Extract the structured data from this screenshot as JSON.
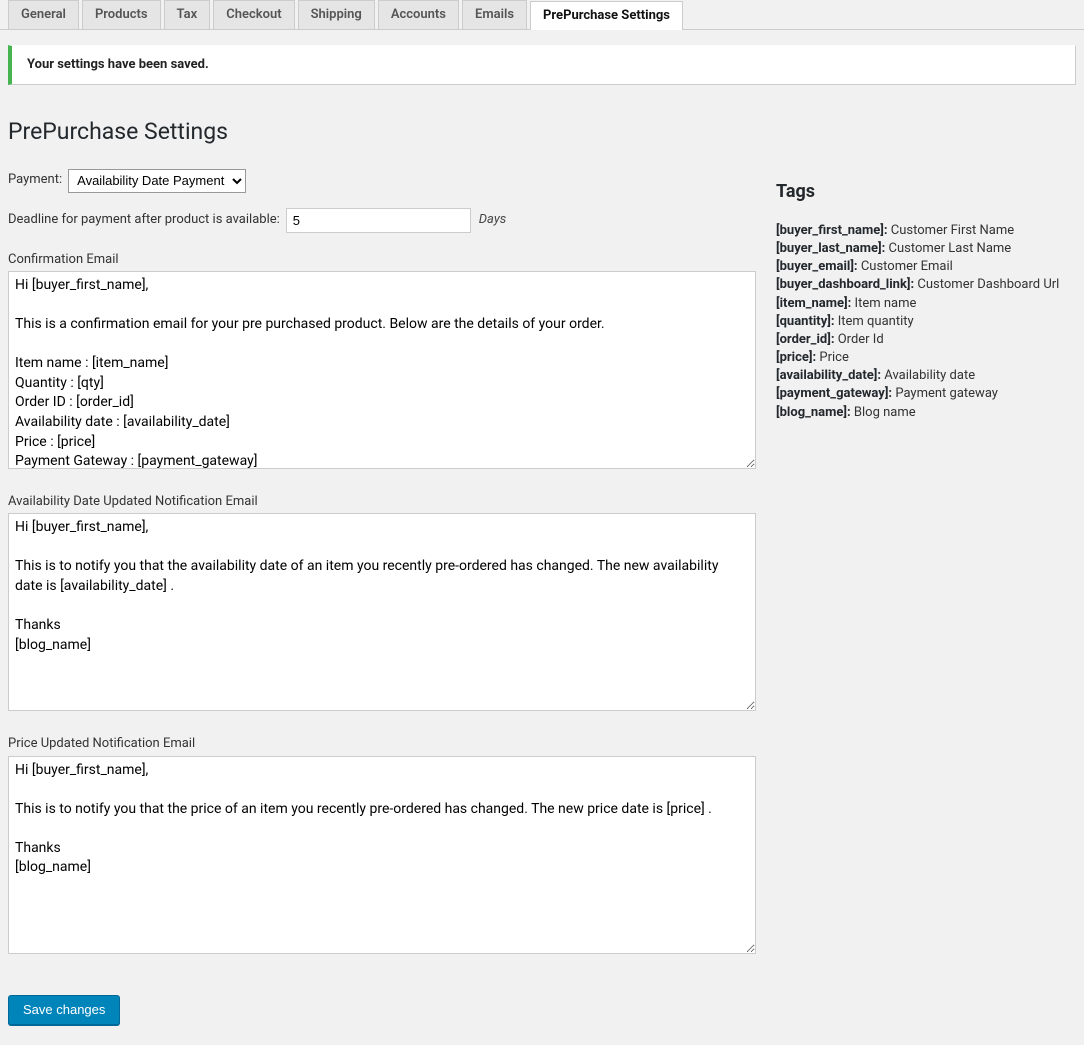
{
  "tabs": {
    "general": "General",
    "products": "Products",
    "tax": "Tax",
    "checkout": "Checkout",
    "shipping": "Shipping",
    "accounts": "Accounts",
    "emails": "Emails",
    "prepurchase": "PrePurchase Settings"
  },
  "notice": "Your settings have been saved.",
  "page_title": "PrePurchase Settings",
  "form": {
    "payment_label": "Payment:",
    "payment_value": "Availability Date Payment",
    "deadline_label": "Deadline for payment after product is available:",
    "deadline_value": "5",
    "days_label": "Days",
    "confirmation_label": "Confirmation Email",
    "confirmation_value": "Hi [buyer_first_name],\n\nThis is a confirmation email for your pre purchased product. Below are the details of your order.\n\nItem name : [item_name]\nQuantity : [qty]\nOrder ID : [order_id]\nAvailability date : [availability_date]\nPrice : [price]\nPayment Gateway : [payment_gateway]",
    "availability_label": "Availability Date Updated Notification Email",
    "availability_value": "Hi [buyer_first_name],\n\nThis is to notify you that the availability date of an item you recently pre-ordered has changed. The new availability date is [availability_date] .\n\nThanks\n[blog_name]",
    "price_label": "Price Updated Notification Email",
    "price_value": "Hi [buyer_first_name],\n\nThis is to notify you that the price of an item you recently pre-ordered has changed. The new price date is [price] .\n\nThanks\n[blog_name]"
  },
  "tags": {
    "heading": "Tags",
    "items": [
      {
        "key": "[buyer_first_name]:",
        "desc": "Customer First Name"
      },
      {
        "key": "[buyer_last_name]:",
        "desc": "Customer Last Name"
      },
      {
        "key": "[buyer_email]:",
        "desc": "Customer Email"
      },
      {
        "key": "[buyer_dashboard_link]:",
        "desc": "Customer Dashboard Url"
      },
      {
        "key": "[item_name]:",
        "desc": "Item name"
      },
      {
        "key": "[quantity]:",
        "desc": "Item quantity"
      },
      {
        "key": "[order_id]:",
        "desc": "Order Id"
      },
      {
        "key": "[price]:",
        "desc": "Price"
      },
      {
        "key": "[availability_date]:",
        "desc": "Availability date"
      },
      {
        "key": "[payment_gateway]:",
        "desc": "Payment gateway"
      },
      {
        "key": "[blog_name]:",
        "desc": "Blog name"
      }
    ]
  },
  "save_button": "Save changes"
}
